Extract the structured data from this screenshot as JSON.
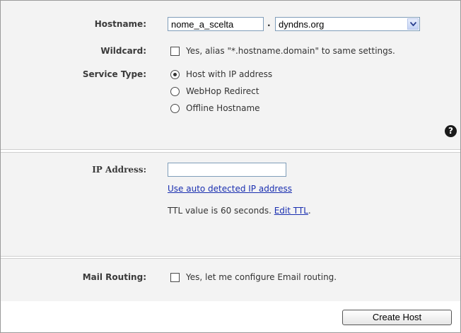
{
  "hostname": {
    "label": "Hostname:",
    "value": "nome_a_scelta",
    "separator": ".",
    "domain_selected": "dyndns.org"
  },
  "wildcard": {
    "label": "Wildcard:",
    "option": "Yes, alias \"*.hostname.domain\" to same settings.",
    "checked": false
  },
  "service_type": {
    "label": "Service Type:",
    "options": [
      {
        "label": "Host with IP address",
        "checked": true
      },
      {
        "label": "WebHop Redirect",
        "checked": false
      },
      {
        "label": "Offline Hostname",
        "checked": false
      }
    ],
    "help_symbol": "?"
  },
  "ip": {
    "label": "IP Address:",
    "value": "",
    "auto_link": "Use auto detected IP address",
    "ttl_text": "TTL value is 60 seconds.",
    "edit_ttl": "Edit TTL",
    "ttl_suffix": "."
  },
  "mail": {
    "label": "Mail Routing:",
    "option": "Yes, let me configure Email routing.",
    "checked": false
  },
  "submit_label": "Create Host",
  "colors": {
    "panel_bg": "#f3f3f3",
    "link": "#1a2fb0",
    "border": "#9a9a9a"
  }
}
